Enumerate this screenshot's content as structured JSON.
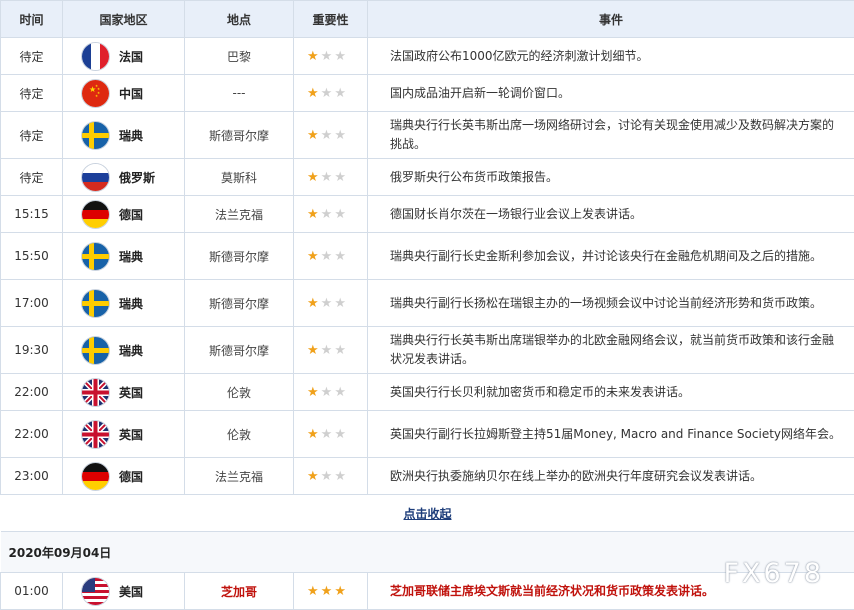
{
  "headers": {
    "time": "时间",
    "country": "国家地区",
    "place": "地点",
    "importance": "重要性",
    "event": "事件"
  },
  "rows": [
    {
      "time": "待定",
      "flag": "france",
      "country": "法国",
      "place": "巴黎",
      "stars": 1,
      "event": "法国政府公布1000亿欧元的经济刺激计划细节。"
    },
    {
      "time": "待定",
      "flag": "china",
      "country": "中国",
      "place": "---",
      "stars": 1,
      "event": "国内成品油开启新一轮调价窗口。"
    },
    {
      "time": "待定",
      "flag": "sweden",
      "country": "瑞典",
      "place": "斯德哥尔摩",
      "stars": 1,
      "event": "瑞典央行行长英韦斯出席一场网络研讨会，讨论有关现金使用减少及数码解决方案的挑战。"
    },
    {
      "time": "待定",
      "flag": "russia",
      "country": "俄罗斯",
      "place": "莫斯科",
      "stars": 1,
      "event": "俄罗斯央行公布货币政策报告。"
    },
    {
      "time": "15:15",
      "flag": "germany",
      "country": "德国",
      "place": "法兰克福",
      "stars": 1,
      "event": "德国财长肖尔茨在一场银行业会议上发表讲话。"
    },
    {
      "time": "15:50",
      "flag": "sweden",
      "country": "瑞典",
      "place": "斯德哥尔摩",
      "stars": 1,
      "event": "瑞典央行副行长史金斯利参加会议，并讨论该央行在金融危机期间及之后的措施。"
    },
    {
      "time": "17:00",
      "flag": "sweden",
      "country": "瑞典",
      "place": "斯德哥尔摩",
      "stars": 1,
      "event": "瑞典央行副行长扬松在瑞银主办的一场视频会议中讨论当前经济形势和货币政策。"
    },
    {
      "time": "19:30",
      "flag": "sweden",
      "country": "瑞典",
      "place": "斯德哥尔摩",
      "stars": 1,
      "event": "瑞典央行行长英韦斯出席瑞银举办的北欧金融网络会议，就当前货币政策和该行金融状况发表讲话。"
    },
    {
      "time": "22:00",
      "flag": "uk",
      "country": "英国",
      "place": "伦敦",
      "stars": 1,
      "event": "英国央行行长贝利就加密货币和稳定币的未来发表讲话。"
    },
    {
      "time": "22:00",
      "flag": "uk",
      "country": "英国",
      "place": "伦敦",
      "stars": 1,
      "event": "英国央行副行长拉姆斯登主持51届Money, Macro and Finance Society网络年会。"
    },
    {
      "time": "23:00",
      "flag": "germany",
      "country": "德国",
      "place": "法兰克福",
      "stars": 1,
      "event": "欧洲央行执委施纳贝尔在线上举办的欧洲央行年度研究会议发表讲话。"
    }
  ],
  "collapse_label": "点击收起",
  "date_label": "2020年09月04日",
  "row_next": {
    "time": "01:00",
    "flag": "usa",
    "country": "美国",
    "place": "芝加哥",
    "stars": 3,
    "event": "芝加哥联储主席埃文斯就当前经济状况和货币政策发表讲话。"
  },
  "watermark": "FX678",
  "colors": {
    "header_bg": "#e8eff9",
    "star": "#f0a11b",
    "highlight": "#c0120c",
    "link": "#1d3d7a"
  }
}
